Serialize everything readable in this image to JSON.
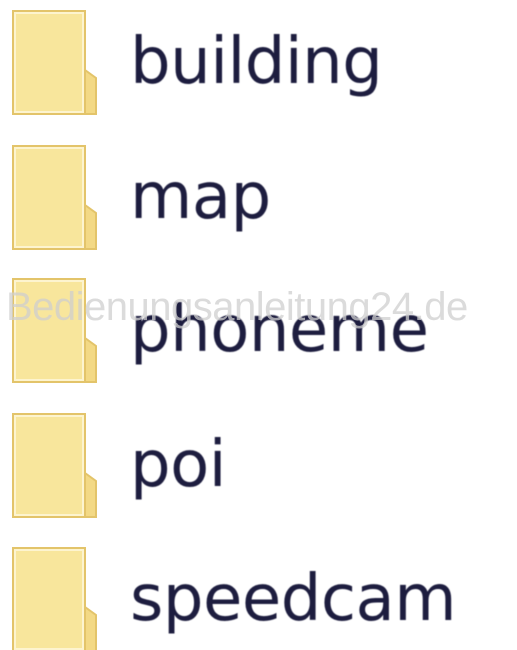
{
  "folders": [
    {
      "name": "building",
      "icon": "folder-icon"
    },
    {
      "name": "map",
      "icon": "folder-icon"
    },
    {
      "name": "phoneme",
      "icon": "folder-icon"
    },
    {
      "name": "poi",
      "icon": "folder-icon"
    },
    {
      "name": "speedcam",
      "icon": "folder-icon"
    }
  ],
  "watermark": "Bedienungsanleitung24.de",
  "colors": {
    "folder_fill": "#f8e69c",
    "folder_edge": "#e3c46a",
    "label_text": "#1d1d3f"
  }
}
